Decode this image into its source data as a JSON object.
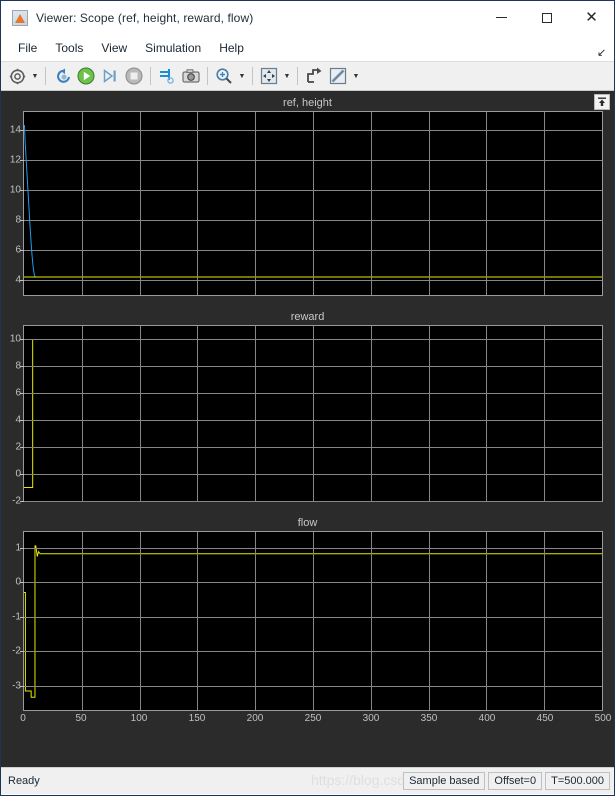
{
  "window": {
    "title": "Viewer: Scope (ref, height, reward, flow)",
    "app_icon": "matlab-scope-icon",
    "controls": {
      "minimize": "minimize-icon",
      "maximize": "maximize-icon",
      "close": "close-icon"
    }
  },
  "menubar": {
    "items": [
      {
        "label": "File"
      },
      {
        "label": "Tools"
      },
      {
        "label": "View"
      },
      {
        "label": "Simulation"
      },
      {
        "label": "Help"
      }
    ],
    "overflow_glyph": "↘"
  },
  "toolbar": {
    "buttons": [
      {
        "name": "configuration-properties-icon",
        "glyph": "⚙",
        "has_caret": true
      },
      {
        "name": "sep-1",
        "glyph": "",
        "has_caret": false
      },
      {
        "name": "run-back-to-start-icon",
        "glyph": "↺",
        "has_caret": false
      },
      {
        "name": "run-icon",
        "glyph": "▶",
        "has_caret": false
      },
      {
        "name": "step-forward-icon",
        "glyph": "▷❘",
        "has_caret": false
      },
      {
        "name": "stop-icon",
        "glyph": "■",
        "has_caret": false
      },
      {
        "name": "sep-2",
        "glyph": "",
        "has_caret": false
      },
      {
        "name": "signal-selector-icon",
        "glyph": "⎇",
        "has_caret": false
      },
      {
        "name": "snapshot-icon",
        "glyph": "◎",
        "has_caret": false
      },
      {
        "name": "sep-3",
        "glyph": "",
        "has_caret": false
      },
      {
        "name": "zoom-in-icon",
        "glyph": "⊕",
        "has_caret": true
      },
      {
        "name": "sep-4",
        "glyph": "",
        "has_caret": false
      },
      {
        "name": "autoscale-icon",
        "glyph": "✥",
        "has_caret": true
      },
      {
        "name": "sep-5",
        "glyph": "",
        "has_caret": false
      },
      {
        "name": "style-icon",
        "glyph": "↱",
        "has_caret": false
      },
      {
        "name": "measurements-icon",
        "glyph": "✏",
        "has_caret": true
      }
    ]
  },
  "scope": {
    "pin_icon": "dock-pin-icon",
    "axis_color": "#c0c0c0",
    "grid_color": "#868686",
    "plot_bg": "#000000",
    "panel_bg": "#2b2b2b",
    "xaxis": {
      "min": 0,
      "max": 500,
      "ticks": [
        0,
        50,
        100,
        150,
        200,
        250,
        300,
        350,
        400,
        450,
        500
      ]
    }
  },
  "chart_data": [
    {
      "type": "line",
      "title": "ref, height",
      "xlabel": "",
      "ylabel": "",
      "xlim": [
        0,
        500
      ],
      "ylim": [
        3.0,
        15.2
      ],
      "yticks": [
        4,
        6,
        8,
        10,
        12,
        14
      ],
      "grid": true,
      "legend": "none",
      "series": [
        {
          "name": "height",
          "color": "#1f9bf0",
          "x": [
            0,
            0.4,
            1,
            1.6,
            2.2,
            2.8,
            3.4,
            4,
            4.6,
            5.2,
            5.8,
            6.4,
            7,
            7.6,
            8.2,
            8.8,
            9.4,
            10,
            12,
            20,
            60,
            120,
            200,
            300,
            400,
            500
          ],
          "y": [
            14.3,
            14.3,
            13.2,
            12.4,
            11.6,
            10.8,
            10.0,
            9.2,
            8.4,
            7.6,
            6.9,
            6.2,
            5.6,
            5.1,
            4.7,
            4.4,
            4.25,
            4.2,
            4.2,
            4.2,
            4.2,
            4.2,
            4.2,
            4.2,
            4.2,
            4.2
          ]
        },
        {
          "name": "ref",
          "color": "#e8e800",
          "x": [
            0,
            2,
            4,
            6,
            8,
            10,
            500
          ],
          "y": [
            4.2,
            4.2,
            4.2,
            4.2,
            4.2,
            4.2,
            4.2
          ]
        }
      ]
    },
    {
      "type": "line",
      "title": "reward",
      "xlabel": "",
      "ylabel": "",
      "xlim": [
        0,
        500
      ],
      "ylim": [
        -2,
        11
      ],
      "yticks": [
        -2,
        0,
        2,
        4,
        6,
        8,
        10
      ],
      "grid": true,
      "legend": "none",
      "series": [
        {
          "name": "reward",
          "color": "#e8e800",
          "x": [
            0,
            7.5,
            7.5,
            50,
            100,
            150,
            200,
            250,
            300,
            350,
            400,
            450,
            500
          ],
          "y": [
            -1.0,
            -1.0,
            10.0,
            10.0,
            10.0,
            10.0,
            10.0,
            10.0,
            10.0,
            10.0,
            10.0,
            10.0,
            10.0
          ]
        }
      ]
    },
    {
      "type": "line",
      "title": "flow",
      "xlabel": "",
      "ylabel": "",
      "xlim": [
        0,
        500
      ],
      "ylim": [
        -3.7,
        1.45
      ],
      "yticks": [
        -3,
        -2,
        -1,
        0,
        1
      ],
      "grid": true,
      "legend": "none",
      "series": [
        {
          "name": "flow",
          "color": "#e8e800",
          "x": [
            0,
            1.2,
            1.2,
            6.2,
            6.2,
            9.5,
            9.5,
            10.2,
            11.5,
            12.5,
            14,
            20,
            60,
            120,
            200,
            300,
            400,
            500
          ],
          "y": [
            -0.3,
            -0.3,
            -3.15,
            -3.15,
            -3.33,
            -3.33,
            1.05,
            1.05,
            0.74,
            0.88,
            0.82,
            0.82,
            0.82,
            0.82,
            0.82,
            0.82,
            0.82,
            0.82
          ]
        }
      ]
    }
  ],
  "statusbar": {
    "ready_label": "Ready",
    "fields": [
      {
        "label": "Sample based"
      },
      {
        "label": "Offset=0"
      },
      {
        "label": "T=500.000"
      }
    ],
    "watermark": "https://blog.csdn.net"
  }
}
